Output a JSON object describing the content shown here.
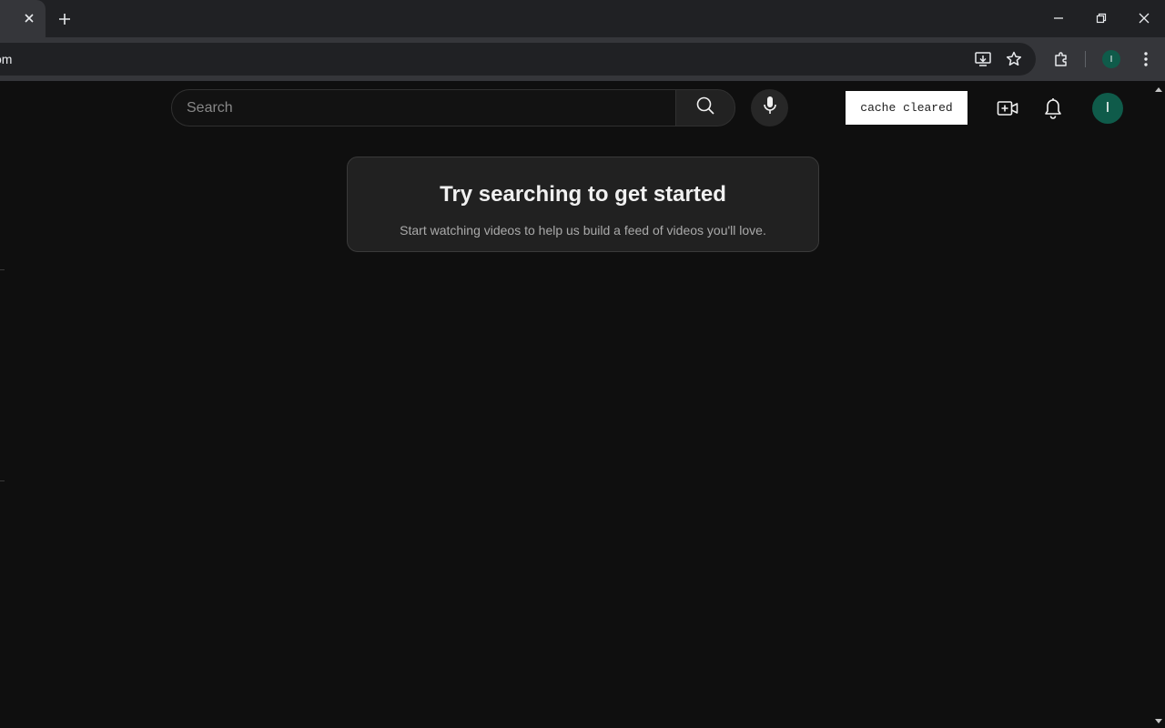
{
  "browser": {
    "tab_close_glyph": "✕",
    "new_tab_glyph": "+",
    "address_text": "om",
    "profile_initial": "I",
    "icons": [
      "install-app-icon",
      "bookmark-star-icon",
      "extensions-icon",
      "kebab-menu-icon",
      "minimize-icon",
      "restore-icon",
      "close-icon"
    ]
  },
  "masthead": {
    "search_placeholder": "Search",
    "search_value": "",
    "cache_badge": "cache cleared",
    "avatar_initial": "I"
  },
  "prompt": {
    "title": "Try searching to get started",
    "subtitle": "Start watching videos to help us build a feed of videos you'll love."
  },
  "colors": {
    "page_bg": "#0f0f0f",
    "avatar_bg": "#0f5b4a",
    "card_bg": "#212121"
  }
}
